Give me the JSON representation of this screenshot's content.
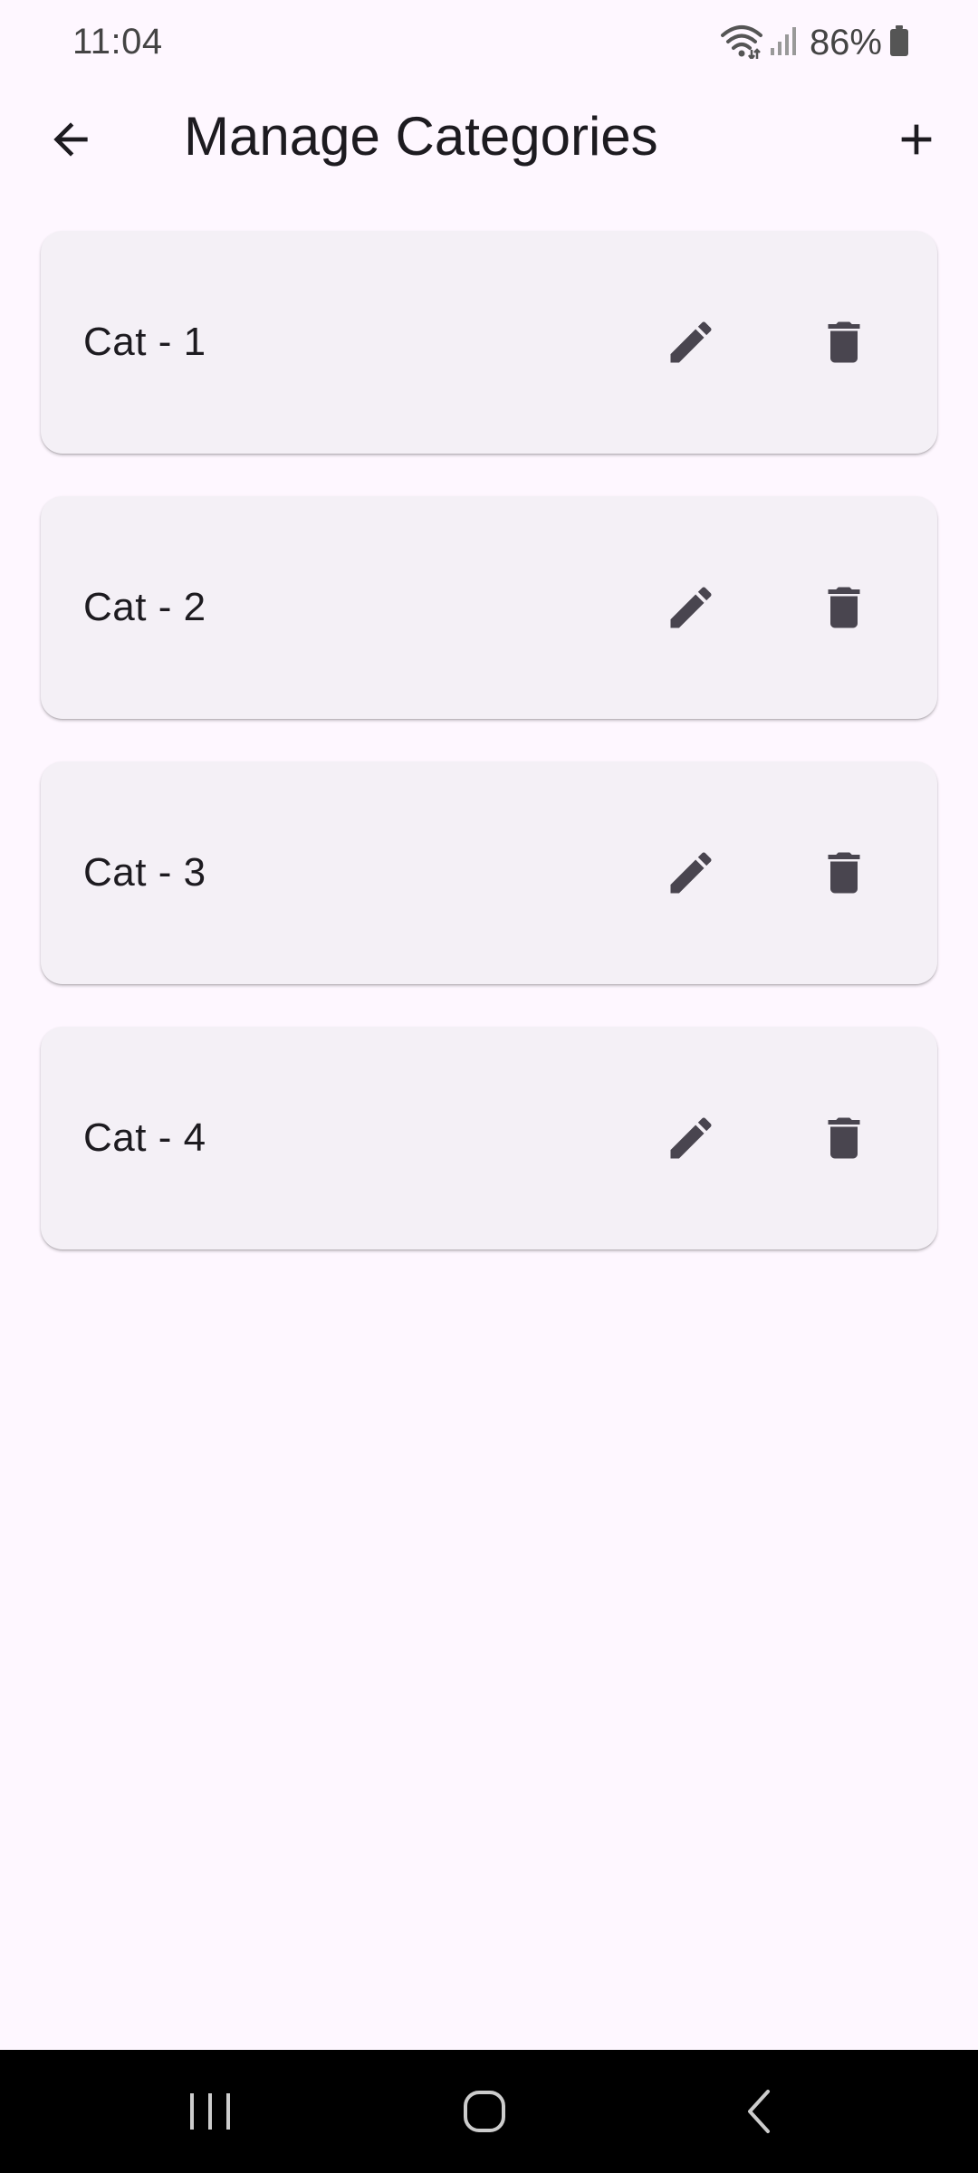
{
  "status_bar": {
    "time": "11:04",
    "battery": "86%",
    "icons": [
      "wifi-icon",
      "signal-icon",
      "battery-icon"
    ]
  },
  "app_bar": {
    "title": "Manage Categories",
    "back_icon": "arrow-back-icon",
    "add_icon": "add-icon"
  },
  "categories": [
    {
      "name": "Cat - 1",
      "edit_icon": "edit-icon",
      "delete_icon": "delete-icon"
    },
    {
      "name": "Cat - 2",
      "edit_icon": "edit-icon",
      "delete_icon": "delete-icon"
    },
    {
      "name": "Cat - 3",
      "edit_icon": "edit-icon",
      "delete_icon": "delete-icon"
    },
    {
      "name": "Cat - 4",
      "edit_icon": "edit-icon",
      "delete_icon": "delete-icon"
    }
  ],
  "nav_bar": {
    "icons": [
      "recents-icon",
      "home-icon",
      "back-icon"
    ]
  },
  "colors": {
    "background": "#fef7ff",
    "card": "#f4f0f6",
    "text": "#1d1b20",
    "icon": "#49454f",
    "nav_bar": "#000000"
  }
}
